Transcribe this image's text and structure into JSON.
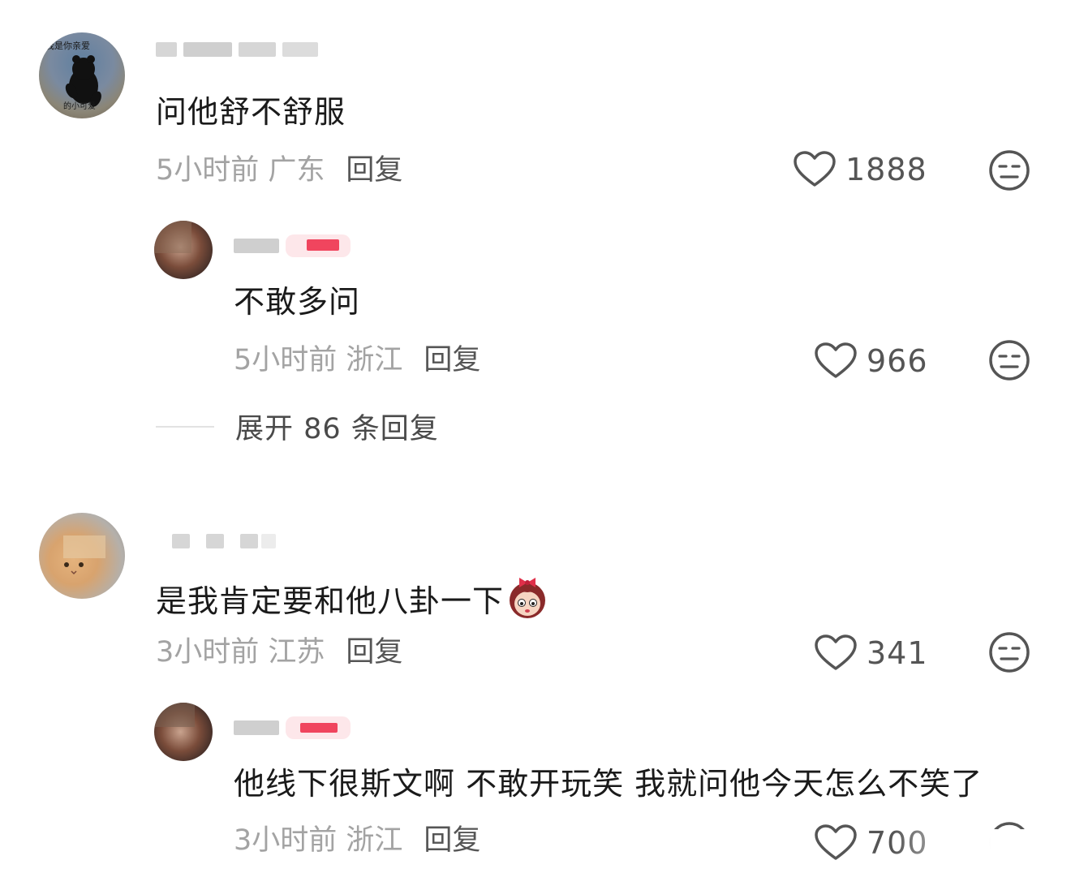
{
  "comments": [
    {
      "text": "问他舒不舒服",
      "time_location": "5小时前 广东",
      "reply_label": "回复",
      "likes": "1888",
      "avatar_caption_top": "我是你亲爱",
      "avatar_caption_bottom": "的小可爱",
      "replies": [
        {
          "text": "不敢多问",
          "time_location": "5小时前 浙江",
          "reply_label": "回复",
          "likes": "966"
        }
      ],
      "expand_label": "展开 86 条回复"
    },
    {
      "text": "是我肯定要和他八卦一下",
      "time_location": "3小时前 江苏",
      "reply_label": "回复",
      "likes": "341",
      "replies": [
        {
          "text": "他线下很斯文啊 不敢开玩笑 我就问他今天怎么不笑了",
          "time_location": "3小时前 浙江",
          "reply_label": "回复",
          "likes": "700"
        }
      ]
    }
  ],
  "icons": {
    "like": "heart-outline-icon",
    "dislike": "unamused-face-icon",
    "inline_emoji": "girl-with-bow-emoji"
  },
  "colors": {
    "text": "#1a1a1a",
    "meta": "#a3a3a3",
    "reply": "#555555",
    "icon": "#555555"
  }
}
